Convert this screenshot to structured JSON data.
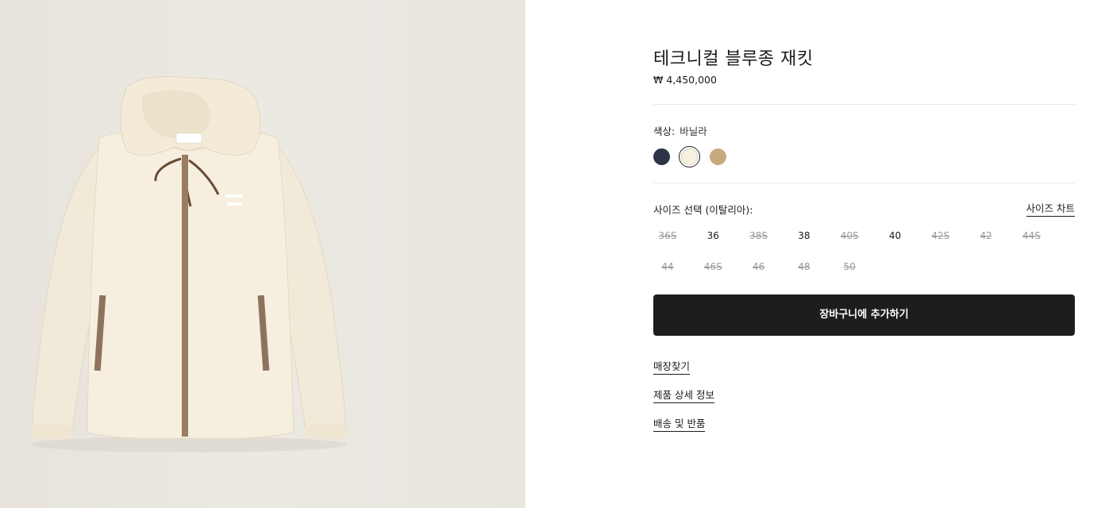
{
  "product": {
    "title": "테크니컬 블루종 재킷",
    "price": "₩ 4,450,000",
    "image_name": "jacket-product-image"
  },
  "color": {
    "label": "색상:",
    "value": "바닐라",
    "swatches": [
      {
        "name": "navy",
        "hex": "#2c3446"
      },
      {
        "name": "vanilla",
        "hex": "#f8f1e1"
      },
      {
        "name": "beige",
        "hex": "#c8a97e"
      }
    ],
    "selected_index": 1
  },
  "size": {
    "label": "사이즈 선택 (이탈리아):",
    "chart_link": "사이즈 차트",
    "options": [
      {
        "label": "36S",
        "available": false
      },
      {
        "label": "36",
        "available": true
      },
      {
        "label": "38S",
        "available": false
      },
      {
        "label": "38",
        "available": true
      },
      {
        "label": "40S",
        "available": false
      },
      {
        "label": "40",
        "available": true
      },
      {
        "label": "42S",
        "available": false
      },
      {
        "label": "42",
        "available": false
      },
      {
        "label": "44S",
        "available": false
      },
      {
        "label": "44",
        "available": false
      },
      {
        "label": "46S",
        "available": false
      },
      {
        "label": "46",
        "available": false
      },
      {
        "label": "48",
        "available": false
      },
      {
        "label": "50",
        "available": false
      }
    ]
  },
  "actions": {
    "add_to_cart": "장바구니에 추가하기"
  },
  "links": {
    "store_finder": "매장찾기",
    "product_details": "제품 상세 정보",
    "shipping_returns": "배송 및 반품"
  }
}
